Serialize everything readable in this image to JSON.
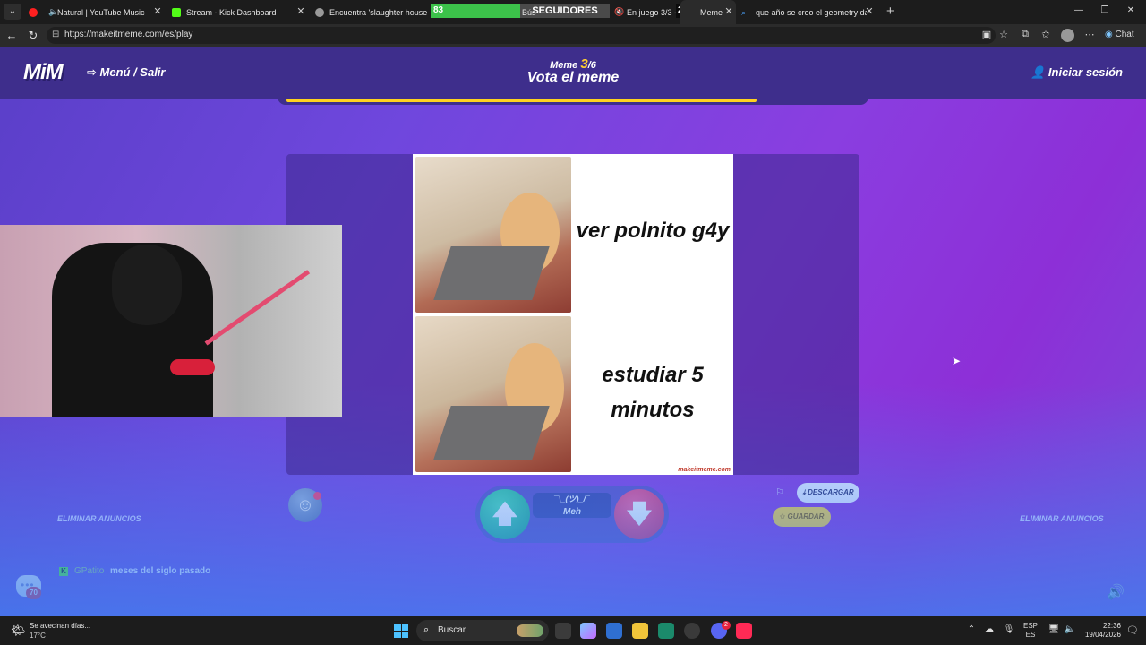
{
  "browser": {
    "tabs": [
      {
        "title": "Natural | YouTube Music",
        "icon_color": "#ff2020"
      },
      {
        "title": "Stream - Kick Dashboard",
        "icon_color": "#53fc18"
      },
      {
        "title": "Encuentra 'slaughter house river",
        "icon_color": "#9a9a9a"
      },
      {
        "title": "Meme",
        "icon_color": "#7a4fe0"
      },
      {
        "title": "que año se creo el geometry dash",
        "icon_color": "#4aa3ff"
      }
    ],
    "overlay": {
      "bar_value": "83",
      "segment_label": "SEGUIDORES",
      "playing_text": "En juego 3/3 -",
      "count": "250",
      "busc_text": "Bús"
    },
    "url": "https://makeitmeme.com/es/play",
    "chat_label": "Chat"
  },
  "header": {
    "logo": "MiM",
    "menu_label": "Menú / Salir",
    "meme_prefix": "Meme",
    "meme_current": "3",
    "meme_total": "/6",
    "title": "Vota el meme",
    "login_label": "Iniciar sesión",
    "progress_fraction": 0.82
  },
  "meme": {
    "caption_top": "ver polnito g4y",
    "caption_bottom_1": "estudiar 5",
    "caption_bottom_2": "minutos",
    "watermark": "makeitmeme.com"
  },
  "vote": {
    "up_symbol": "🡅",
    "down_symbol": "🡇",
    "shrug": "¯\\_(ツ)_/¯",
    "meh_label": "Meh"
  },
  "actions": {
    "download_label": "DESCARGAR",
    "save_label": "GUARDAR",
    "ads_left": "ELIMINAR ANUNCIOS",
    "ads_right": "ELIMINAR ANUNCIOS"
  },
  "chat": {
    "badge": "70",
    "username": "GPatito",
    "message": "meses del siglo pasado"
  },
  "taskbar": {
    "weather_text": "Se avecinan días...",
    "temperature": "17°C",
    "search_label": "Buscar",
    "lang_1": "ESP",
    "lang_2": "ES",
    "time": "22:36",
    "date": "19/04/2026",
    "discord_badge": "2"
  }
}
